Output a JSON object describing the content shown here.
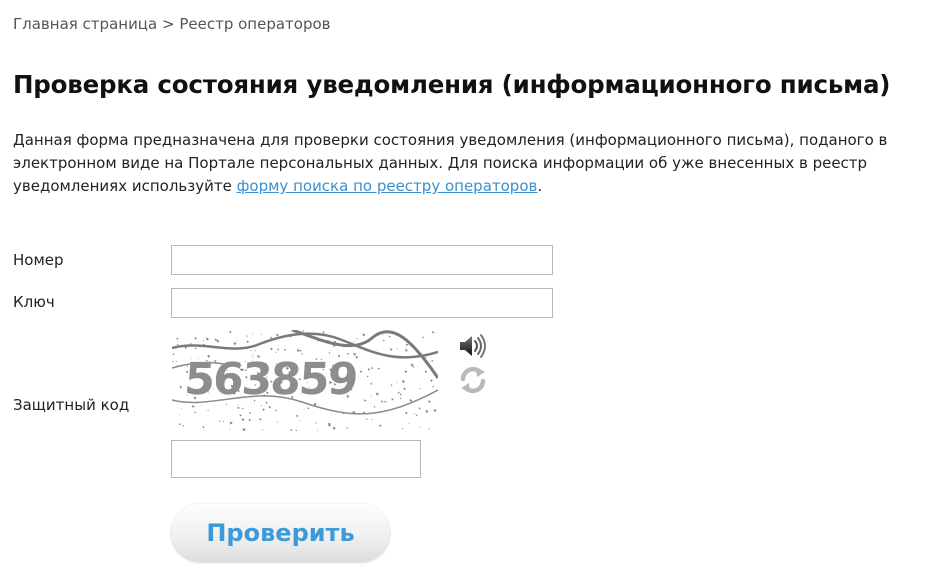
{
  "breadcrumb": {
    "home": "Главная страница",
    "separator": " > ",
    "current": "Реестр операторов"
  },
  "page": {
    "title": "Проверка состояния уведомления (информационного письма)",
    "description_before": "Данная форма предназначена для проверки состояния уведомления (информационного письма), поданого в электронном виде на Портале персональных данных. Для поиска информации об уже внесенных в реестр уведомлениях используйте ",
    "description_link": "форму поиска по реестру операторов",
    "description_after": "."
  },
  "form": {
    "number_label": "Номер",
    "number_value": "",
    "key_label": "Ключ",
    "key_value": "",
    "captcha_label": "Защитный код",
    "captcha_text": "563859",
    "captcha_value": "",
    "submit_label": "Проверить"
  },
  "colors": {
    "link": "#3a8fce",
    "button_text": "#3d9ad8"
  },
  "icons": {
    "audio": "speaker-icon",
    "refresh": "refresh-icon"
  }
}
